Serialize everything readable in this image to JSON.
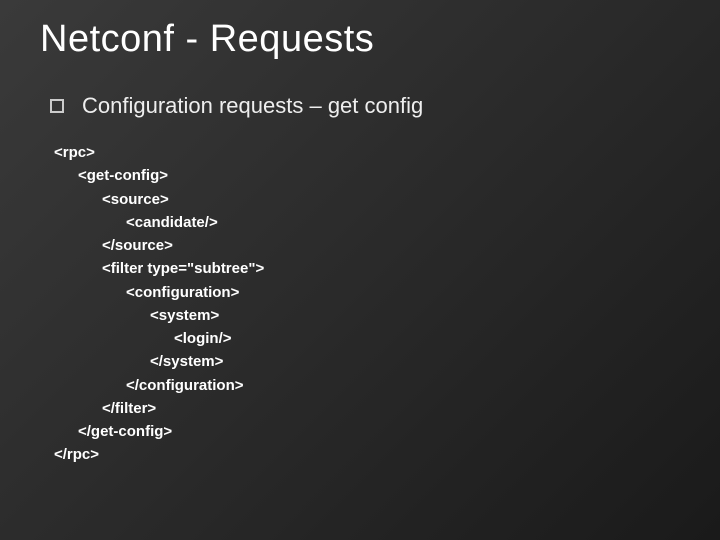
{
  "title": "Netconf - Requests",
  "bullet": "Configuration requests – get config",
  "code": {
    "l1": "<rpc>",
    "l2": "<get-config>",
    "l3": "<source>",
    "l4": "<candidate/>",
    "l5": "</source>",
    "l6": "<filter type=\"subtree\">",
    "l7": "<configuration>",
    "l8": "<system>",
    "l9": "<login/>",
    "l10": "</system>",
    "l11": "</configuration>",
    "l12": "</filter>",
    "l13": "</get-config>",
    "l14": "</rpc>"
  }
}
